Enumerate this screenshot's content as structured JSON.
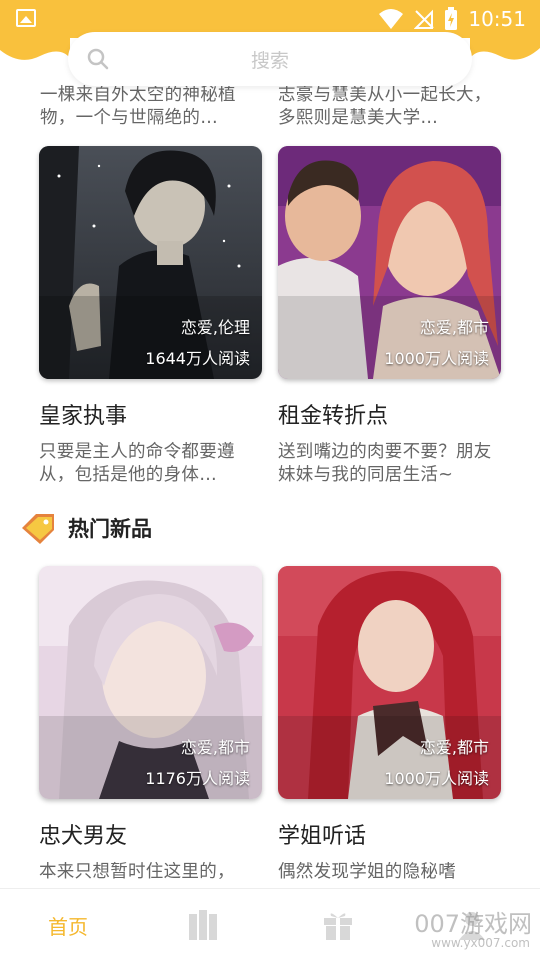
{
  "status_bar": {
    "time": "10:51"
  },
  "search": {
    "placeholder": "搜索"
  },
  "top_row": [
    {
      "desc": "一棵来自外太空的神秘植物，一个与世隔绝的…"
    },
    {
      "desc": "志豪与慧美从小一起长大，多熙则是慧美大学…"
    }
  ],
  "recommend_cards": [
    {
      "title": "皇家执事",
      "tags": "恋爱,伦理",
      "reads": "1644万人阅读",
      "desc": "只要是主人的命令都要遵从，包括是他的身体…"
    },
    {
      "title": "租金转折点",
      "tags": "恋爱,都市",
      "reads": "1000万人阅读",
      "desc": "送到嘴边的肉要不要？朋友妹妹与我的同居生活~"
    }
  ],
  "hot_section": {
    "title": "热门新品",
    "cards": [
      {
        "title": "忠犬男友",
        "tags": "恋爱,都市",
        "reads": "1176万人阅读",
        "desc": "本来只想暂时住这里的，"
      },
      {
        "title": "学姐听话",
        "tags": "恋爱,都市",
        "reads": "1000万人阅读",
        "desc": "偶然发现学姐的隐秘嗜"
      }
    ]
  },
  "bottom_nav": {
    "home": "首页"
  },
  "watermark": {
    "text": "007游戏网",
    "sub": "www.yx007.com"
  },
  "colors": {
    "accent": "#f9c13d",
    "nav_active": "#f5b82e"
  }
}
